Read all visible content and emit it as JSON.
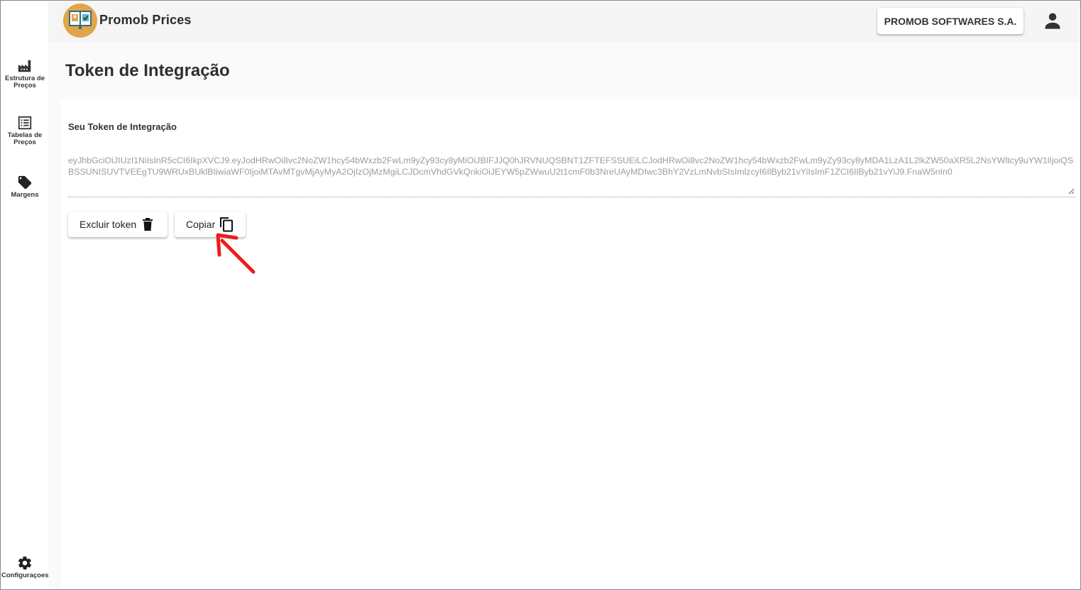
{
  "header": {
    "app_title": "Promob Prices",
    "company_button": "PROMOB SOFTWARES S.A."
  },
  "sidebar": {
    "items": [
      {
        "label_line1": "Estrutura de",
        "label_line2": "Preços",
        "icon": "factory-icon"
      },
      {
        "label_line1": "Tabelas de",
        "label_line2": "Preços",
        "icon": "list-icon"
      },
      {
        "label_line1": "Margens",
        "label_line2": "",
        "icon": "tag-icon"
      }
    ],
    "settings": {
      "label": "Configuraçoes",
      "icon": "gear-icon"
    }
  },
  "page": {
    "title": "Token de Integração",
    "token_label": "Seu Token de Integração",
    "token_value": "eyJhbGciOiJIUzI1NiIsInR5cCI6IkpXVCJ9.eyJodHRwOi8vc2NoZW1hcy54bWxzb2FwLm9yZy93cy8yMiOiJBIFJJQ0hJRVNUQSBNT1ZFTEFSSUEiLCJodHRwOi8vc2NoZW1hcy54bWxzb2FwLm9yZy93cy8yMDA1LzA1L2lkZW50aXR5L2NsYWltcy9uYW1lIjoiQSBSSUNISUVTVEEgTU9WRUxBUklBIiwiaWF0IjoiMTAvMTgvMjAyMyA2OjIzOjMzMgiLCJDcmVhdGVkQnkiOiJEYW5pZWwuU2t1cmF0b3NreUAyMDIwc3BhY2VzLmNvbSIsImlzcyI6IlByb21vYiIsImF1ZCI6IlByb21vYiJ9.FnaW5nIn0",
    "delete_button": "Excluir token",
    "copy_button": "Copiar"
  },
  "colors": {
    "logo_bg": "#e3a549",
    "annotation_arrow": "#ee1c1c"
  }
}
